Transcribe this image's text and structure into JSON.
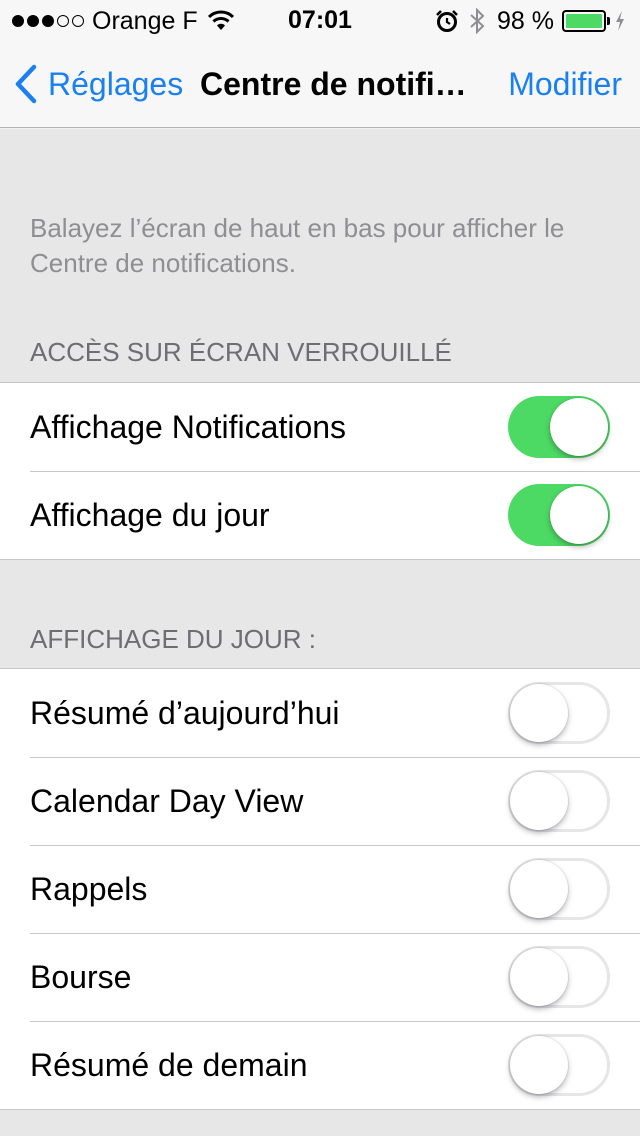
{
  "status_bar": {
    "carrier": "Orange F",
    "time": "07:01",
    "battery_percent": "98 %",
    "signal_bars_filled": 3,
    "signal_bars_total": 5,
    "icons": [
      "wifi-icon",
      "alarm-icon",
      "bluetooth-icon",
      "battery-icon",
      "charging-icon"
    ]
  },
  "nav": {
    "back_label": "Réglages",
    "title": "Centre de notifications",
    "edit_label": "Modifier"
  },
  "intro": "Balayez l’écran de haut en bas pour afficher le Centre de notifications.",
  "lock_screen_section": {
    "header": "ACCÈS SUR ÉCRAN VERROUILLÉ",
    "rows": [
      {
        "label": "Affichage Notifications",
        "on": true
      },
      {
        "label": "Affichage du jour",
        "on": true
      }
    ]
  },
  "today_section": {
    "header": "AFFICHAGE DU JOUR :",
    "rows": [
      {
        "label": "Résumé d’aujourd’hui",
        "on": false
      },
      {
        "label": "Calendar Day View",
        "on": false
      },
      {
        "label": "Rappels",
        "on": false
      },
      {
        "label": "Bourse",
        "on": false
      },
      {
        "label": "Résumé de demain",
        "on": false
      }
    ]
  },
  "colors": {
    "accent": "#1a80f0",
    "toggle_on": "#4cd964",
    "background": "#e7e7e7"
  }
}
